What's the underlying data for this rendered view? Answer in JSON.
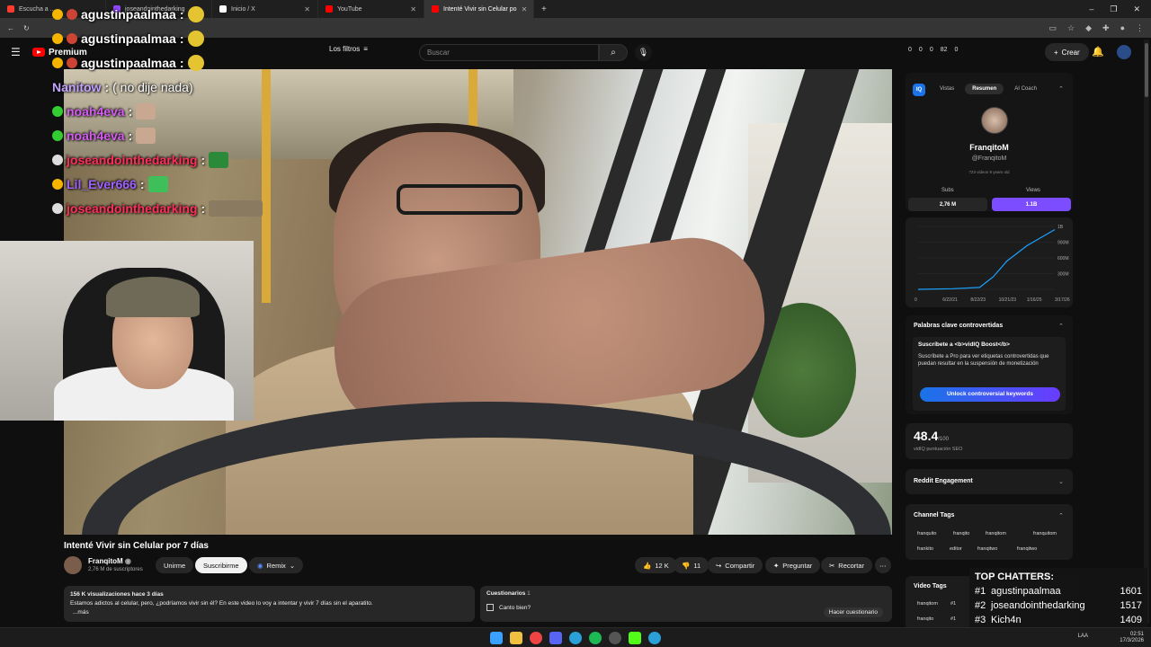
{
  "tabs": [
    {
      "label": "Escucha a ...",
      "color": "#ff3b30",
      "active": false
    },
    {
      "label": "joseandointhedarking",
      "color": "#9147ff",
      "active": false
    },
    {
      "label": "Inicio / X",
      "color": "#ffffff",
      "active": false
    },
    {
      "label": "YouTube",
      "color": "#ff0000",
      "active": false
    },
    {
      "label": "Intenté Vivir sin Celular po",
      "color": "#ff0000",
      "active": true
    }
  ],
  "youtube": {
    "logo": "Premium",
    "filters": "Los filtros",
    "search_placeholder": "Buscar",
    "create": "Crear",
    "stats": [
      "0",
      "0",
      "0",
      "82",
      "0"
    ]
  },
  "chat": [
    {
      "user": "agustinpaalmaa",
      "color": "#ffffff",
      "message": ""
    },
    {
      "user": "agustinpaalmaa",
      "color": "#ffffff",
      "message": ""
    },
    {
      "user": "agustinpaalmaa",
      "color": "#ffffff",
      "message": ""
    },
    {
      "user": "Nanitow",
      "color": "#c4a3ff",
      "message": "( no dije nada)"
    },
    {
      "user": "noah4eva",
      "color": "#d45cf0",
      "message": ""
    },
    {
      "user": "noah4eva",
      "color": "#d45cf0",
      "message": ""
    },
    {
      "user": "joseandointhedarking",
      "color": "#ff2f5c",
      "message": ""
    },
    {
      "user": "Lil_Ever666",
      "color": "#a060ff",
      "message": ""
    },
    {
      "user": "joseandointhedarking",
      "color": "#ff2f5c",
      "message": ""
    }
  ],
  "video": {
    "title": "Intenté Vivir sin Celular por 7 días",
    "channel": "FranqitoM",
    "subscribers": "2,76 M de suscriptores",
    "join": "Unirme",
    "subscribe": "Suscribirme",
    "remix": "Remix",
    "likes": "12 K",
    "dislikes": "11",
    "share": "Compartir",
    "ask": "Preguntar",
    "clip": "Recortar",
    "views_line": "156 K visualizaciones  hace 3 días",
    "description": "Estamos adictos al celular, pero, ¿podríamos vivir sin él? En este video lo voy a intentar y vivir 7 días sin el aparatito.",
    "more": "...más",
    "quiz_title": "Cuestionarios",
    "quiz_count": "1",
    "quiz_item": "Canto bien?",
    "quiz_button": "Hacer cuestionario"
  },
  "vidiq": {
    "tabs": [
      "Vistas",
      "Resumen",
      "AI Coach"
    ],
    "name": "FranqitoM",
    "handle": "@FranqitoM",
    "meta": "723 videos   9 years old",
    "subs_label": "Subs",
    "subs_value": "2,76 M",
    "views_label": "Views",
    "views_value": "1.1B",
    "chart_x": [
      "0",
      "6/22/21",
      "8/22/23",
      "10/21/23",
      "1/16/25",
      "3/17/26"
    ],
    "chart_y": [
      "1B",
      "900M",
      "600M",
      "300M",
      "0"
    ],
    "controversial_title": "Palabras clave controvertidas",
    "boost_title": "Suscríbete a <b>vidIQ Boost</b>",
    "boost_text": "Suscríbete a Pro para ver etiquetas controvertidas que puedan resultar en la suspensión de monetización",
    "unlock": "Unlock controversial keywords",
    "seo_score": "48.4",
    "seo_max": "/100",
    "seo_label": "vidIQ puntuación SEO",
    "reddit": "Reddit Engagement",
    "channel_tags": "Channel Tags",
    "tags": [
      "franquito",
      "franqito",
      "franqitom",
      "franquitom",
      "frankito",
      "editor",
      "franqitwo",
      "franqitwo"
    ],
    "video_tags": "Video Tags",
    "video_tag_items": [
      "franqitom",
      "#1",
      "franqito",
      "#1"
    ]
  },
  "chatters": {
    "header": "TOP CHATTERS:",
    "rows": [
      {
        "rank": "#1",
        "name": "agustinpaalmaa",
        "count": "1601"
      },
      {
        "rank": "#2",
        "name": "joseandointhedarking",
        "count": "1517"
      },
      {
        "rank": "#3",
        "name": "Kich4n",
        "count": "1409"
      }
    ]
  },
  "taskbar": {
    "time": "02:51",
    "date": "17/3/2026",
    "lang": "LAA"
  },
  "chart_data": {
    "type": "line",
    "x": [
      "6/22/21",
      "8/22/23",
      "10/21/23",
      "1/16/25",
      "3/17/26"
    ],
    "y_ticks": [
      "0",
      "300M",
      "600M",
      "900M",
      "1B"
    ],
    "series": [
      {
        "points_x": [
          0,
          0.25,
          0.45,
          0.55,
          0.65,
          0.8,
          1.0
        ],
        "values": [
          0,
          10,
          30,
          200,
          450,
          700,
          950
        ]
      }
    ]
  }
}
